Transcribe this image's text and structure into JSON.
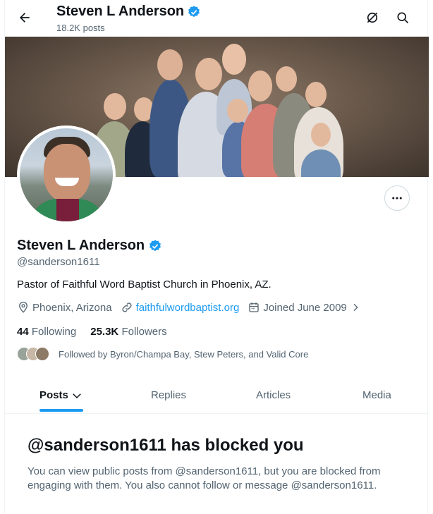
{
  "header": {
    "title": "Steven L Anderson",
    "post_count": "18.2K posts"
  },
  "profile": {
    "name": "Steven L Anderson",
    "handle": "@sanderson1611",
    "bio": "Pastor of Faithful Word Baptist Church in Phoenix, AZ.",
    "location": "Phoenix, Arizona",
    "website": "faithfulwordbaptist.org",
    "joined": "Joined June 2009",
    "following_count": "44",
    "following_label": "Following",
    "followers_count": "25.3K",
    "followers_label": "Followers",
    "followed_by": "Followed by Byron/Champa Bay, Stew Peters, and Valid Core"
  },
  "tabs": [
    {
      "label": "Posts"
    },
    {
      "label": "Replies"
    },
    {
      "label": "Articles"
    },
    {
      "label": "Media"
    }
  ],
  "blocked": {
    "title": "@sanderson1611 has blocked you",
    "message": "You can view public posts from @sanderson1611, but you are blocked from engaging with them. You also cannot follow or message @sanderson1611."
  },
  "colors": {
    "accent": "#1d9bf0",
    "text_primary": "#0f1419",
    "text_secondary": "#536471",
    "verified": "#1d9bf0"
  },
  "icons": [
    "back-arrow-icon",
    "grok-icon",
    "search-icon",
    "verified-badge-icon",
    "more-icon",
    "location-icon",
    "link-icon",
    "calendar-icon",
    "chevron-right-icon",
    "chevron-down-icon"
  ]
}
